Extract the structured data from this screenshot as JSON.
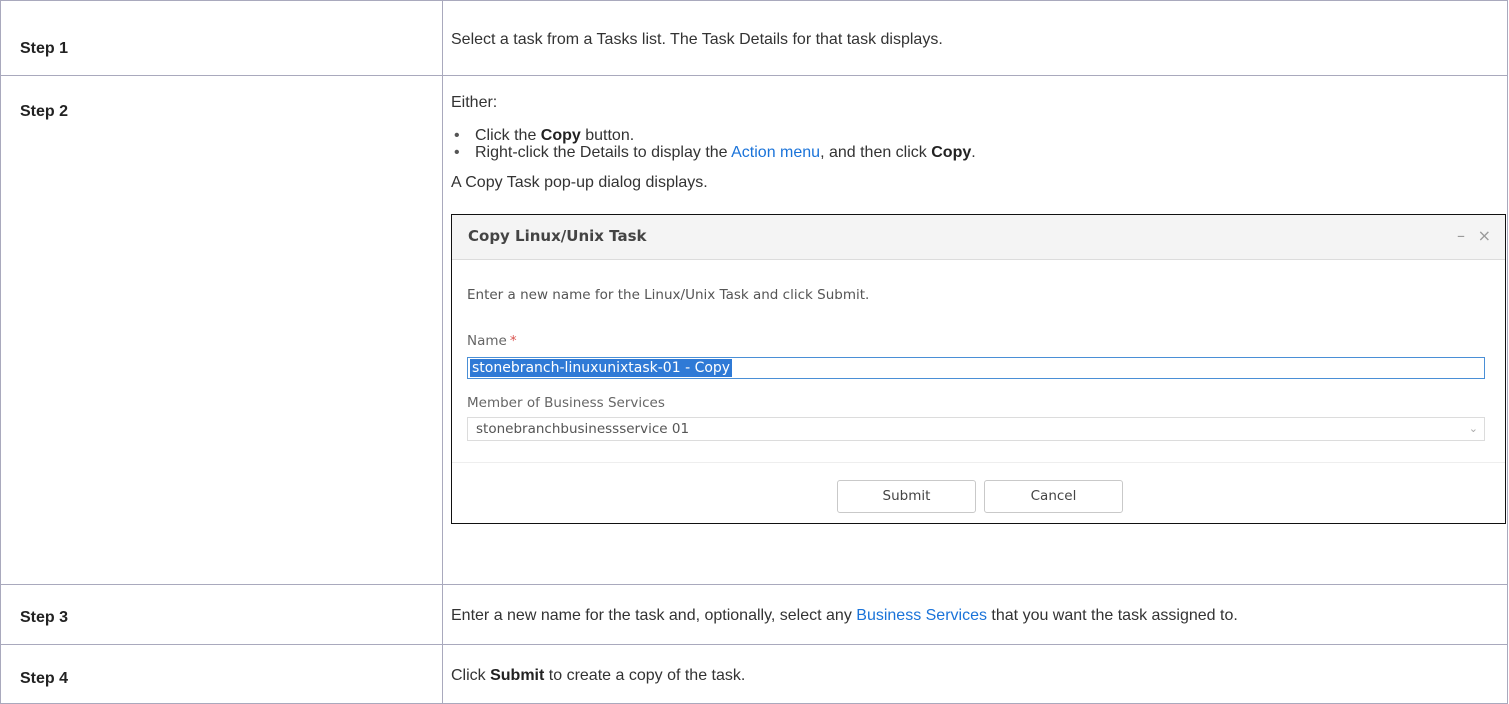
{
  "steps": [
    {
      "label": "Step 1",
      "text": "Select a task from a Tasks list. The Task Details for that task displays."
    },
    {
      "label": "Step 2",
      "intro": "Either:",
      "options": [
        {
          "prefix": "Click the ",
          "bold": "Copy",
          "suffix": " button."
        },
        {
          "prefix": "Right-click the Details to display the ",
          "link": "Action menu",
          "middle": ", and then click ",
          "bold": "Copy",
          "suffix": "."
        }
      ],
      "after": "A Copy Task pop-up dialog displays."
    },
    {
      "label": "Step 3",
      "prefix": "Enter a new name for the task and, optionally, select any ",
      "link": "Business Services",
      "suffix": " that you want the task assigned to."
    },
    {
      "label": "Step 4",
      "prefix": "Click ",
      "bold": "Submit",
      "suffix": " to create a copy of the task."
    }
  ],
  "dialog": {
    "title": "Copy Linux/Unix Task",
    "minimize_glyph": "–",
    "close_glyph": "×",
    "instruction": "Enter a new name for the Linux/Unix Task and click Submit.",
    "name_label": "Name",
    "required_mark": "*",
    "name_value": "stonebranch-linuxunixtask-01 - Copy",
    "business_services_label": "Member of Business Services",
    "business_services_value": "stonebranchbusinessservice 01",
    "dropdown_glyph": "⌄",
    "submit_label": "Submit",
    "cancel_label": "Cancel"
  },
  "colors": {
    "link": "#1a73d9",
    "border": "#a9a9bd",
    "selection": "#2f7ad6",
    "required": "#d9534f"
  },
  "icons": {
    "bullet": "•",
    "minimize": "minimize-icon",
    "close": "close-icon",
    "dropdown": "chevron-down-icon"
  }
}
